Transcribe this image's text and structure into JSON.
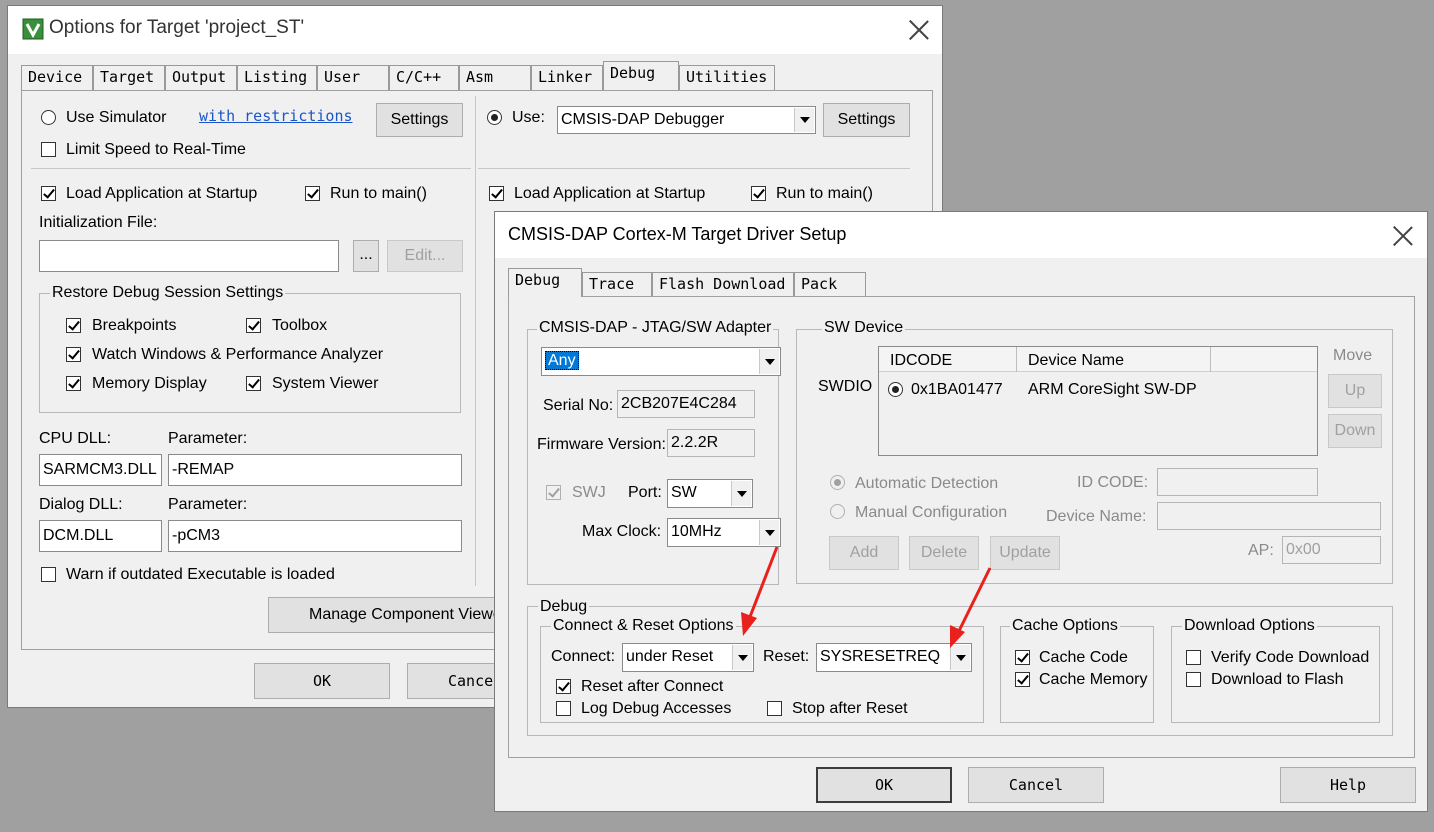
{
  "back_dialog": {
    "title": "Options for Target 'project_ST'",
    "tabs": [
      "Device",
      "Target",
      "Output",
      "Listing",
      "User",
      "C/C++",
      "Asm",
      "Linker",
      "Debug",
      "Utilities"
    ],
    "active_tab": "Debug",
    "use_simulator_label": "Use Simulator",
    "with_restrictions_link": "with restrictions",
    "settings_label": "Settings",
    "limit_speed_label": "Limit Speed to Real-Time",
    "load_app_label": "Load Application at Startup",
    "run_to_main_label": "Run to main()",
    "init_file_label": "Initialization File:",
    "init_file_value": "",
    "browse_label": "...",
    "edit_label": "Edit...",
    "restore_group_label": "Restore Debug Session Settings",
    "breakpoints_label": "Breakpoints",
    "toolbox_label": "Toolbox",
    "watch_windows_label": "Watch Windows & Performance Analyzer",
    "memory_display_label": "Memory Display",
    "system_viewer_label": "System Viewer",
    "cpu_dll_label": "CPU DLL:",
    "cpu_dll_value": "SARMCM3.DLL",
    "parameter_label": "Parameter:",
    "cpu_param_value": "-REMAP",
    "dialog_dll_label": "Dialog DLL:",
    "dialog_dll_value": "DCM.DLL",
    "dialog_param_value": "-pCM3",
    "warn_outdated_label": "Warn if outdated Executable is loaded",
    "manage_component_label": "Manage Component Viewe",
    "use_label": "Use:",
    "debugger_value": "CMSIS-DAP Debugger",
    "right_load_app_label": "Load Application at Startup",
    "right_run_to_main_label": "Run to main()",
    "ok_label": "OK",
    "cancel_label": "Cancel"
  },
  "front_dialog": {
    "title": "CMSIS-DAP Cortex-M Target Driver Setup",
    "tabs": [
      "Debug",
      "Trace",
      "Flash Download",
      "Pack"
    ],
    "active_tab": "Debug",
    "adapter_group_label": "CMSIS-DAP - JTAG/SW Adapter",
    "adapter_value": "Any",
    "serial_no_label": "Serial No:",
    "serial_no_value": "2CB207E4C284",
    "firmware_label": "Firmware Version:",
    "firmware_value": "2.2.2R",
    "swj_label": "SWJ",
    "port_label": "Port:",
    "port_value": "SW",
    "max_clock_label": "Max Clock:",
    "max_clock_value": "10MHz",
    "sw_device_group_label": "SW Device",
    "swdio_label": "SWDIO",
    "table_headers": [
      "IDCODE",
      "Device Name"
    ],
    "table_rows": [
      [
        "0x1BA01477",
        "ARM CoreSight SW-DP"
      ]
    ],
    "move_label": "Move",
    "up_label": "Up",
    "down_label": "Down",
    "auto_detect_label": "Automatic Detection",
    "manual_config_label": "Manual Configuration",
    "id_code_label": "ID CODE:",
    "device_name_label": "Device Name:",
    "add_label": "Add",
    "delete_label": "Delete",
    "update_label": "Update",
    "ap_label": "AP:",
    "ap_value": "0x00",
    "debug_group_label": "Debug",
    "connect_reset_group_label": "Connect & Reset Options",
    "connect_label": "Connect:",
    "connect_value": "under Reset",
    "reset_label": "Reset:",
    "reset_value": "SYSRESETREQ",
    "reset_after_connect_label": "Reset after Connect",
    "log_debug_label": "Log Debug Accesses",
    "stop_after_reset_label": "Stop after Reset",
    "cache_group_label": "Cache Options",
    "cache_code_label": "Cache Code",
    "cache_memory_label": "Cache Memory",
    "download_group_label": "Download Options",
    "verify_download_label": "Verify Code Download",
    "download_flash_label": "Download to Flash",
    "ok_label": "OK",
    "cancel_label": "Cancel",
    "help_label": "Help"
  },
  "colors": {
    "dialog_bg": "#f0f0f0",
    "selection": "#0078d7",
    "annotation_arrow": "#e8211d",
    "link": "#1a56c8"
  }
}
